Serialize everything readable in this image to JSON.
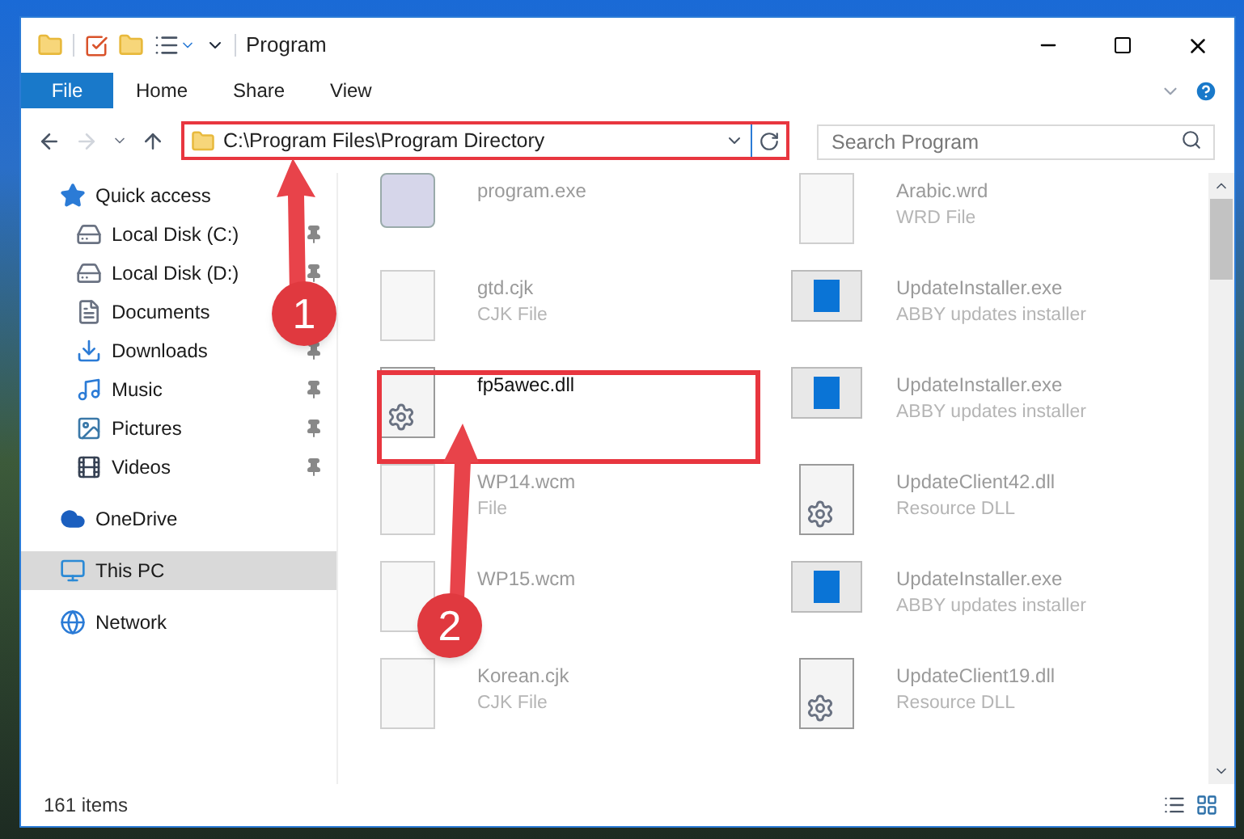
{
  "window": {
    "title": "Program"
  },
  "ribbon_tabs": [
    {
      "label": "File",
      "kind": "file"
    },
    {
      "label": "Home",
      "kind": "tab"
    },
    {
      "label": "Share",
      "kind": "tab"
    },
    {
      "label": "View",
      "kind": "tab"
    }
  ],
  "address": {
    "path": "C:\\Program Files\\Program Directory"
  },
  "search": {
    "placeholder": "Search Program"
  },
  "sidebar": {
    "items": [
      {
        "label": "Quick access",
        "kind": "star",
        "selected": false,
        "children": [
          {
            "label": "Local Disk (C:)",
            "kind": "disk",
            "pinned": true
          },
          {
            "label": "Local Disk (D:)",
            "kind": "disk",
            "pinned": true
          },
          {
            "label": "Documents",
            "kind": "documents",
            "pinned": false
          },
          {
            "label": "Downloads",
            "kind": "downloads",
            "pinned": true
          },
          {
            "label": "Music",
            "kind": "music",
            "pinned": true
          },
          {
            "label": "Pictures",
            "kind": "pictures",
            "pinned": true
          },
          {
            "label": "Videos",
            "kind": "videos",
            "pinned": true
          }
        ]
      },
      {
        "label": "OneDrive",
        "kind": "cloud",
        "selected": false
      },
      {
        "label": "This PC",
        "kind": "pc",
        "selected": true
      },
      {
        "label": "Network",
        "kind": "network",
        "selected": false
      }
    ]
  },
  "files": [
    {
      "name": "program.exe",
      "kind": "program",
      "blurred": true
    },
    {
      "name": "Arabic.wrd",
      "type": "WRD File",
      "kind": "blank",
      "blurred": true
    },
    {
      "name": "gtd.cjk",
      "type": "CJK File",
      "kind": "blank",
      "blurred": true
    },
    {
      "name": "UpdateInstaller.exe",
      "type": "ABBY updates installer",
      "kind": "installer",
      "blurred": true
    },
    {
      "name": "fp5awec.dll",
      "kind": "dll",
      "blurred": false
    },
    {
      "name": "UpdateInstaller.exe",
      "type": "ABBY updates installer",
      "kind": "installer",
      "blurred": true
    },
    {
      "name": "WP14.wcm",
      "type": "File",
      "kind": "blank",
      "blurred": true
    },
    {
      "name": "UpdateClient42.dll",
      "type": "Resource DLL",
      "kind": "dll",
      "blurred": true
    },
    {
      "name": "WP15.wcm",
      "kind": "blank",
      "blurred": true
    },
    {
      "name": "UpdateInstaller.exe",
      "type": "ABBY updates installer",
      "kind": "installer",
      "blurred": true
    },
    {
      "name": "Korean.cjk",
      "type": "CJK File",
      "kind": "blank",
      "blurred": true
    },
    {
      "name": "UpdateClient19.dll",
      "type": "Resource DLL",
      "kind": "dll",
      "blurred": true
    }
  ],
  "status_bar": {
    "count": "161 items"
  },
  "annotations": [
    {
      "number": "1"
    },
    {
      "number": "2"
    }
  ]
}
